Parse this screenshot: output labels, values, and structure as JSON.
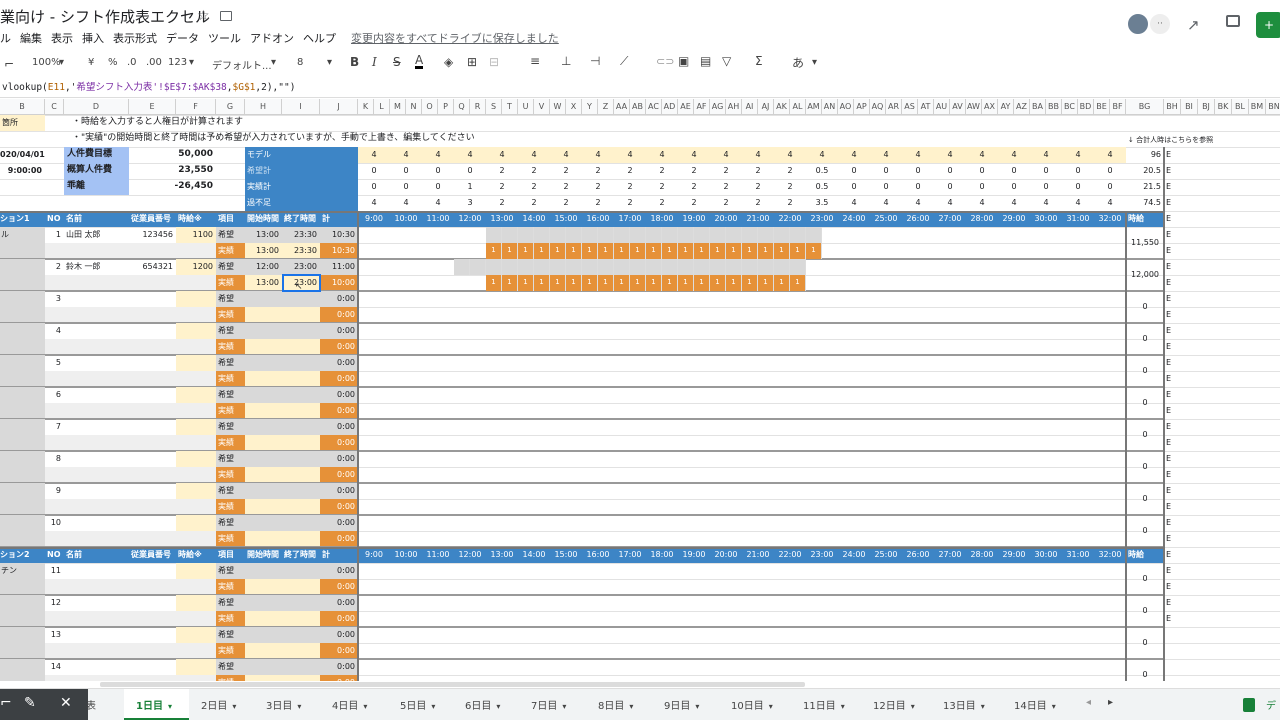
{
  "doc": {
    "title": "業向け - シフト作成表エクセル",
    "saved": "変更内容をすべてドライブに保存しました"
  },
  "menu": [
    "ル",
    "編集",
    "表示",
    "挿入",
    "表示形式",
    "データ",
    "ツール",
    "アドオン",
    "ヘルプ"
  ],
  "toolbar": {
    "zoom": "100%",
    "currency": "¥",
    "percent": "%",
    "dec_less": ".0",
    "dec_more": ".00",
    "format": "123",
    "font": "デフォルト...",
    "size": "8",
    "input": "あ"
  },
  "formula": {
    "prefix": "vlookup(",
    "ref1": "E11",
    "mid": ",'",
    "sheetname": "希望シフト入力表",
    "range": "'!$E$7:$AK$38",
    "comma": ",",
    "ref2": "$G$1",
    "tail": ",2),\"\")"
  },
  "col_headers": [
    "B",
    "C",
    "D",
    "E",
    "F",
    "G",
    "H",
    "I",
    "J",
    "K",
    "L",
    "M",
    "N",
    "O",
    "P",
    "Q",
    "R",
    "S",
    "T",
    "U",
    "V",
    "W",
    "X",
    "Y",
    "Z",
    "AA",
    "AB",
    "AC",
    "AD",
    "AE",
    "AF",
    "AG",
    "AH",
    "AI",
    "AJ",
    "AK",
    "AL",
    "AM",
    "AN",
    "AO",
    "AP",
    "AQ",
    "AR",
    "AS",
    "AT",
    "AU",
    "AV",
    "AW",
    "AX",
    "AY",
    "AZ",
    "BA",
    "BB",
    "BC",
    "BD",
    "BE",
    "BF",
    "BG",
    "BH",
    "BI",
    "BJ",
    "BK",
    "BL",
    "BM",
    "BN"
  ],
  "notes": {
    "place": "箇所",
    "n1": "・時給を入力すると人権日が計算されます",
    "n2": "・\"実績\"の開始時間と終了時間は予め希望が入力されていますが、手動で上書き、編集してください",
    "ref": "↓ 合計人時はこちらを参照"
  },
  "summary": {
    "date": "020/04/01",
    "time": "9:00:00",
    "l1": "人件費目標",
    "v1": "50,000",
    "l2": "概算人件費",
    "v2": "23,550",
    "l3": "乖離",
    "v3": "-26,450"
  },
  "rows4": {
    "model": "モデル",
    "wish": "希望計",
    "actual": "実績計",
    "diff": "過不足"
  },
  "model_vals": [
    "4",
    "4",
    "4",
    "4",
    "4",
    "4",
    "4",
    "4",
    "4",
    "4",
    "4",
    "4",
    "4",
    "4",
    "4",
    "4",
    "4",
    "4",
    "4",
    "4",
    "4",
    "4",
    "4",
    "4"
  ],
  "wish_vals": [
    "0",
    "0",
    "0",
    "0",
    "2",
    "2",
    "2",
    "2",
    "2",
    "2",
    "2",
    "2",
    "2",
    "2",
    "0.5",
    "0",
    "0",
    "0",
    "0",
    "0",
    "0",
    "0",
    "0",
    "0"
  ],
  "actual_vals": [
    "0",
    "0",
    "0",
    "1",
    "2",
    "2",
    "2",
    "2",
    "2",
    "2",
    "2",
    "2",
    "2",
    "2",
    "0.5",
    "0",
    "0",
    "0",
    "0",
    "0",
    "0",
    "0",
    "0",
    "0"
  ],
  "diff_vals": [
    "4",
    "4",
    "4",
    "3",
    "2",
    "2",
    "2",
    "2",
    "2",
    "2",
    "2",
    "2",
    "2",
    "2",
    "3.5",
    "4",
    "4",
    "4",
    "4",
    "4",
    "4",
    "4",
    "4",
    "4"
  ],
  "totals_top": [
    "96",
    "20.5",
    "21.5",
    "74.5"
  ],
  "header": {
    "sec1": "ション1",
    "sec2": "ション2",
    "no": "NO",
    "name": "名前",
    "emp": "従業員番号",
    "wage": "時給※",
    "item": "項目",
    "start": "開始時間",
    "end": "終了時間",
    "sum": "計",
    "total": "時給"
  },
  "hours": [
    "9:00",
    "10:00",
    "11:00",
    "12:00",
    "13:00",
    "14:00",
    "15:00",
    "16:00",
    "17:00",
    "18:00",
    "19:00",
    "20:00",
    "21:00",
    "22:00",
    "23:00",
    "24:00",
    "25:00",
    "26:00",
    "27:00",
    "28:00",
    "29:00",
    "30:00",
    "31:00",
    "32:00"
  ],
  "wish_label": "希望",
  "actual_label": "実績",
  "staff": [
    {
      "no": "1",
      "name": "山田 太郎",
      "emp": "123456",
      "wage": "1100",
      "ws": "13:00",
      "we": "23:30",
      "wt": "10:30",
      "as": "13:00",
      "ae": "23:30",
      "at": "10:30",
      "total": "11,550",
      "dept": "ル"
    },
    {
      "no": "2",
      "name": "鈴木 一郎",
      "emp": "654321",
      "wage": "1200",
      "ws": "12:00",
      "we": "23:00",
      "wt": "11:00",
      "as": "13:00",
      "ae": "23:00",
      "at": "10:00",
      "total": "12,000"
    },
    {
      "no": "3",
      "zero": "0:00",
      "total": "0"
    },
    {
      "no": "4",
      "zero": "0:00",
      "total": "0"
    },
    {
      "no": "5",
      "zero": "0:00",
      "total": "0"
    },
    {
      "no": "6",
      "zero": "0:00",
      "total": "0"
    },
    {
      "no": "7",
      "zero": "0:00",
      "total": "0"
    },
    {
      "no": "8",
      "zero": "0:00",
      "total": "0"
    },
    {
      "no": "9",
      "zero": "0:00",
      "total": "0"
    },
    {
      "no": "10",
      "zero": "0:00",
      "total": "0"
    }
  ],
  "staff2": [
    {
      "no": "11",
      "zero": "0:00",
      "total": "0",
      "dept": "チン"
    },
    {
      "no": "12",
      "zero": "0:00",
      "total": "0"
    },
    {
      "no": "13",
      "zero": "0:00",
      "total": "0"
    },
    {
      "no": "14",
      "zero": "0:00",
      "total": "0"
    }
  ],
  "one": "1",
  "e_char": "E",
  "tabs": [
    "表",
    "1日目",
    "2日目",
    "3日目",
    "4日目",
    "5日目",
    "6日目",
    "7日目",
    "8日目",
    "9日目",
    "10日目",
    "11日目",
    "12日目",
    "13日目",
    "14日目"
  ]
}
